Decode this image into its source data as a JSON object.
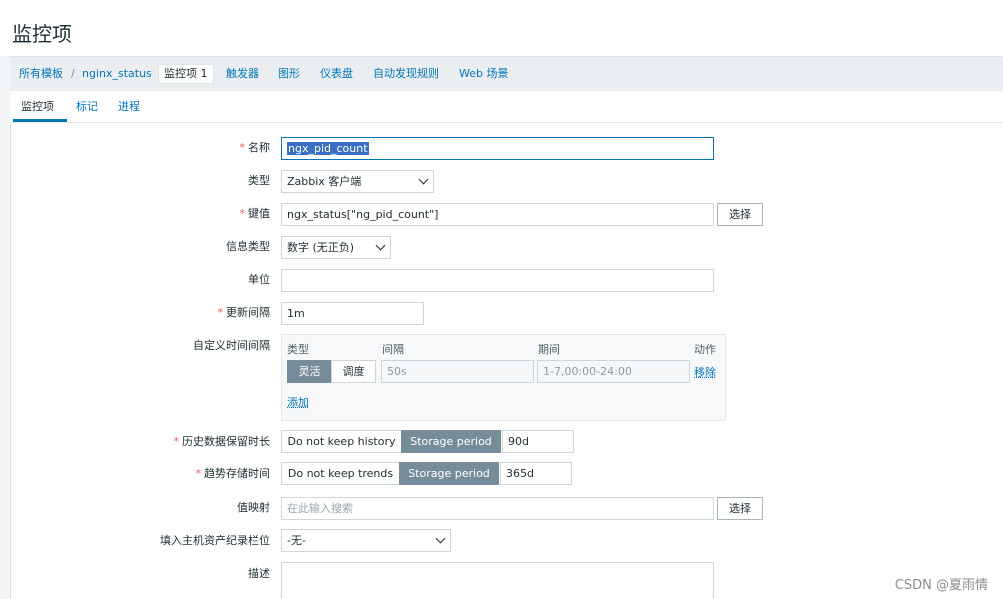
{
  "page_title": "监控项",
  "nav": {
    "all_templates": "所有模板",
    "separator": "/",
    "template_name": "nginx_status",
    "items_label": "监控项",
    "items_count": "1",
    "triggers": "触发器",
    "graphs": "图形",
    "dashboards": "仪表盘",
    "discovery": "自动发现规则",
    "web": "Web 场景"
  },
  "tabs": {
    "item": "监控项",
    "tags": "标记",
    "preprocessing": "进程"
  },
  "form": {
    "required_mark": "*",
    "name_label": "名称",
    "name_value": "ngx_pid_count",
    "type_label": "类型",
    "type_value": "Zabbix 客户端",
    "key_label": "键值",
    "key_value": "ngx_status[\"ng_pid_count\"]",
    "select_button": "选择",
    "info_type_label": "信息类型",
    "info_type_value": "数字 (无正负)",
    "units_label": "单位",
    "units_value": "",
    "interval_label": "更新间隔",
    "interval_value": "1m",
    "custom_intervals_label": "自定义时间间隔",
    "custom": {
      "col_type": "类型",
      "col_interval": "间隔",
      "col_period": "期间",
      "col_action": "动作",
      "flexible": "灵活",
      "scheduling": "调度",
      "interval_placeholder": "50s",
      "period_placeholder": "1-7,00:00-24:00",
      "remove": "移除",
      "add": "添加"
    },
    "history_label": "历史数据保留时长",
    "history_no_keep": "Do not keep history",
    "history_storage": "Storage period",
    "history_value": "90d",
    "trends_label": "趋势存储时间",
    "trends_no_keep": "Do not keep trends",
    "trends_storage": "Storage period",
    "trends_value": "365d",
    "valuemap_label": "值映射",
    "valuemap_placeholder": "在此输入搜索",
    "inventory_label": "填入主机资产纪录栏位",
    "inventory_value": "-无-",
    "description_label": "描述"
  },
  "watermark": "CSDN @夏雨情"
}
